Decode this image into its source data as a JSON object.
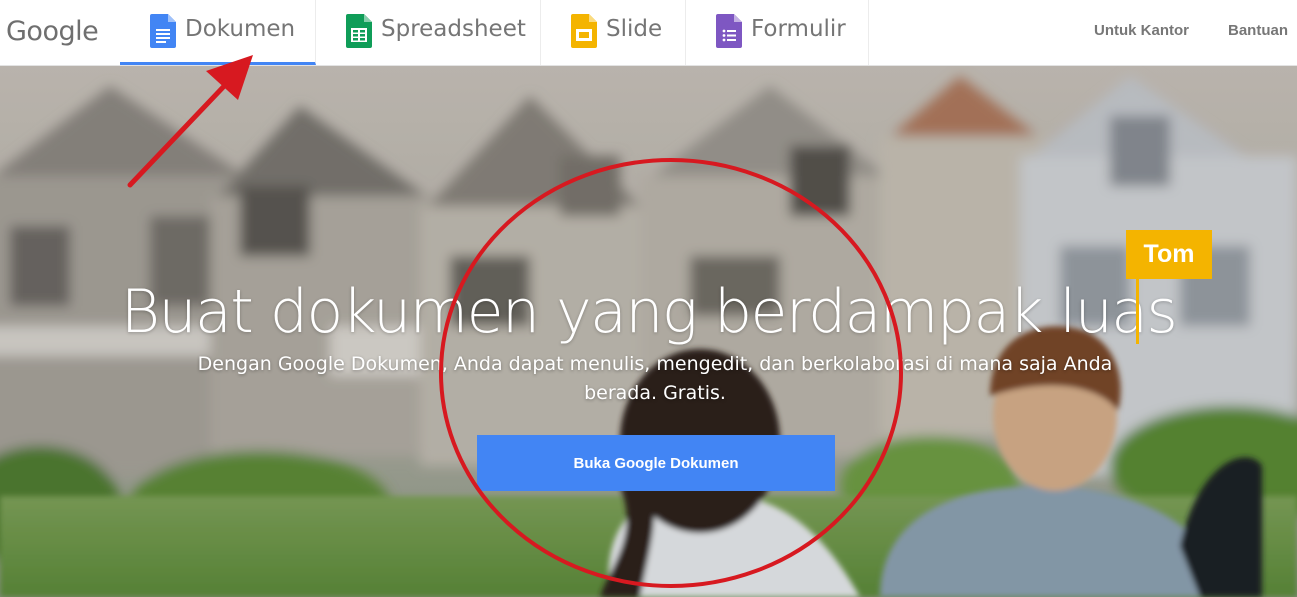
{
  "header": {
    "logo": "Google",
    "tabs": [
      {
        "label": "Dokumen",
        "icon": "docs-icon",
        "color": "#4285f4",
        "active": true
      },
      {
        "label": "Spreadsheet",
        "icon": "sheets-icon",
        "color": "#0f9d58",
        "active": false
      },
      {
        "label": "Slide",
        "icon": "slides-icon",
        "color": "#f4b400",
        "active": false
      },
      {
        "label": "Formulir",
        "icon": "forms-icon",
        "color": "#7e57c2",
        "active": false
      }
    ],
    "links": {
      "work": "Untuk Kantor",
      "help": "Bantuan"
    }
  },
  "hero": {
    "headline": "Buat dokumen yang berdampak luas",
    "subtext": "Dengan Google Dokumen, Anda dapat menulis, mengedit, dan berkolaborasi di mana saja Anda berada. Gratis.",
    "cta_label": "Buka Google Dokumen",
    "collaborator_name": "Tom",
    "collaborator_color": "#f4b400"
  },
  "annotations": {
    "arrow_color": "#d71920",
    "circle_color": "#d71920"
  }
}
